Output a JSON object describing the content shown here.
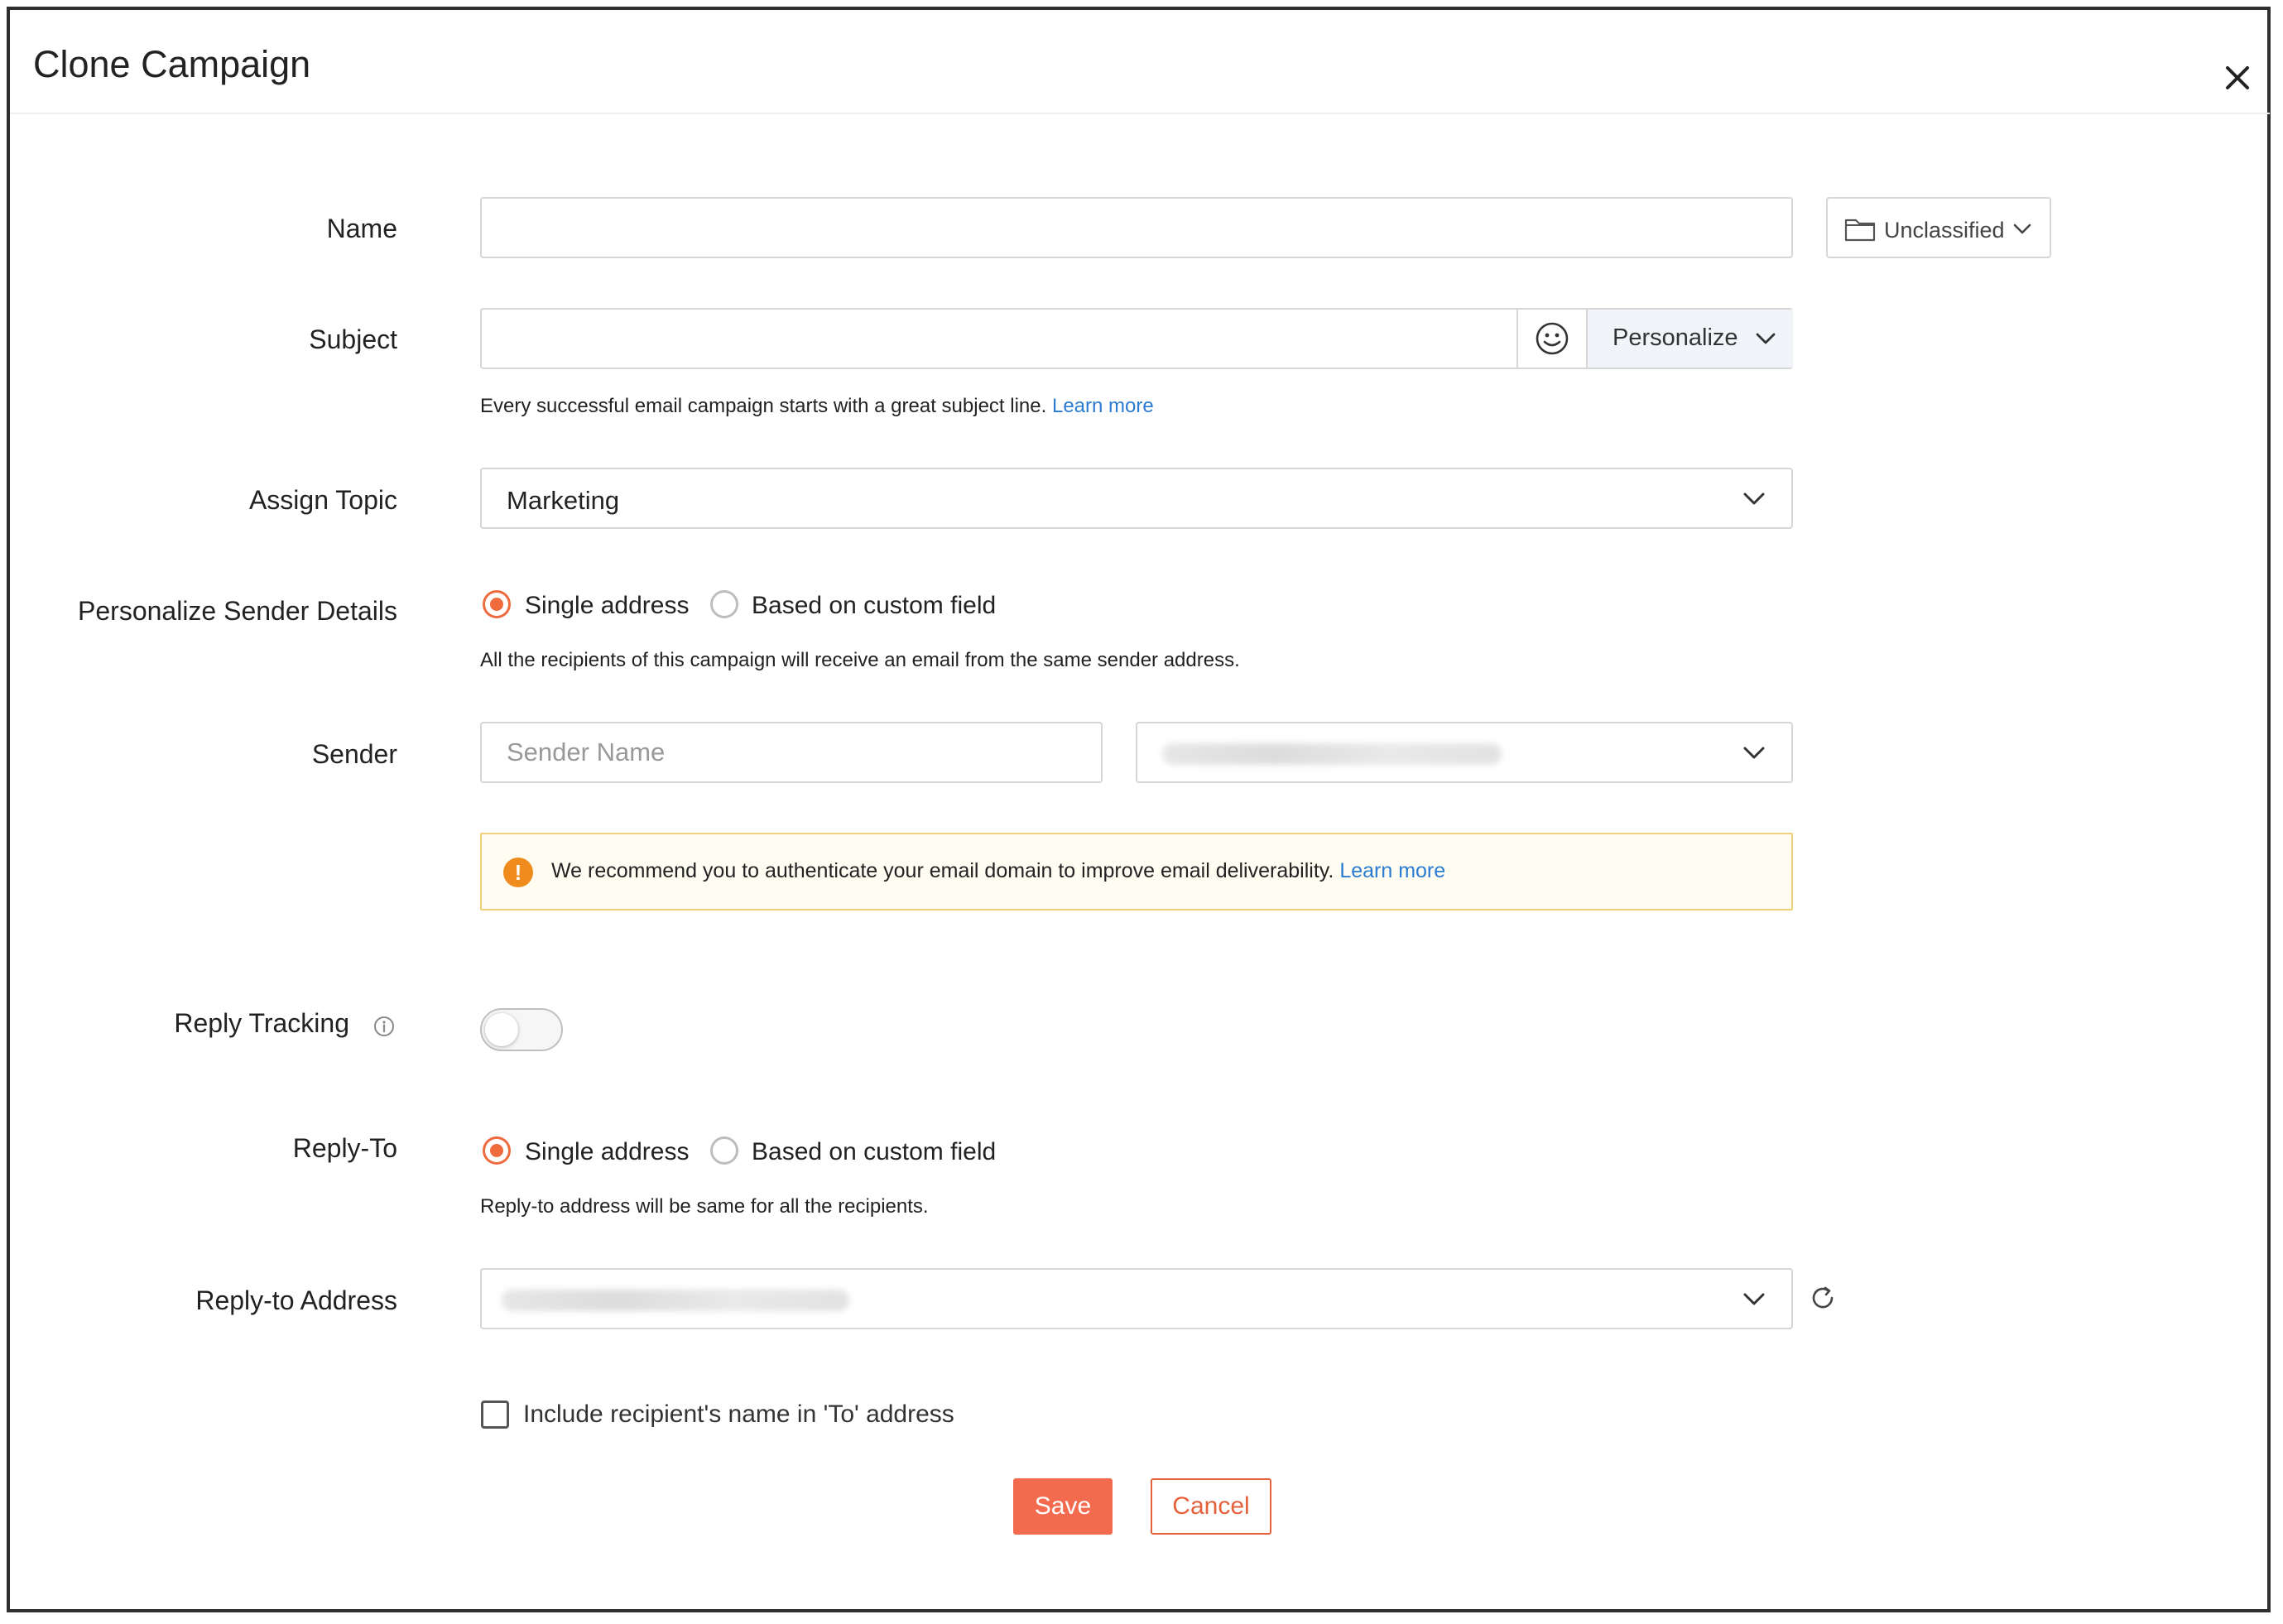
{
  "dialog": {
    "title": "Clone Campaign"
  },
  "name": {
    "label": "Name",
    "value": "",
    "placeholder": ""
  },
  "folder": {
    "label": "Unclassified"
  },
  "subject": {
    "label": "Subject",
    "value": "",
    "placeholder": "",
    "personalize_label": "Personalize",
    "helper_text": "Every successful email campaign starts with a great subject line.",
    "helper_link": "Learn more"
  },
  "topic": {
    "label": "Assign Topic",
    "selected": "Marketing"
  },
  "sender_details": {
    "label": "Personalize Sender Details",
    "options": [
      "Single address",
      "Based on custom field"
    ],
    "selected_index": 0,
    "helper_text": "All the recipients of this campaign will receive an email from the same sender address."
  },
  "sender": {
    "label": "Sender",
    "name_placeholder": "Sender Name"
  },
  "alert": {
    "text": "We recommend you to authenticate your email domain to improve email deliverability.",
    "link": "Learn more"
  },
  "reply_tracking": {
    "label": "Reply Tracking",
    "enabled": false
  },
  "reply_to": {
    "label": "Reply-To",
    "options": [
      "Single address",
      "Based on custom field"
    ],
    "selected_index": 0,
    "helper_text": "Reply-to address will be same for all the recipients."
  },
  "reply_address": {
    "label": "Reply-to Address"
  },
  "include_name": {
    "label": "Include recipient's name in 'To' address",
    "checked": false
  },
  "actions": {
    "save_label": "Save",
    "cancel_label": "Cancel"
  },
  "colors": {
    "accent": "#f26b4e",
    "link": "#2a7bd1",
    "alert_border": "#f2cf7a",
    "alert_icon": "#f08c1e"
  }
}
